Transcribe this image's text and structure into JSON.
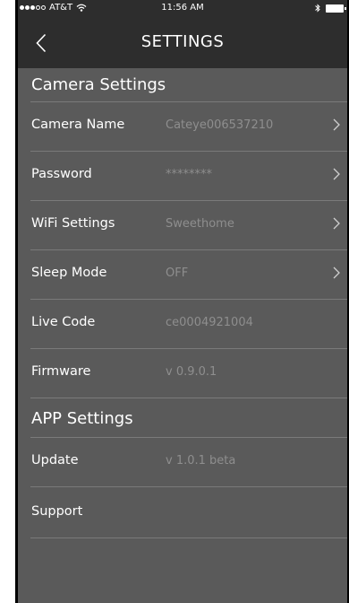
{
  "status_bar": {
    "carrier": "AT&T",
    "time": "11:56 AM"
  },
  "nav": {
    "title": "SETTINGS"
  },
  "sections": [
    {
      "title": "Camera Settings",
      "rows": [
        {
          "label": "Camera Name",
          "value": "Cateye006537210",
          "has_chevron": true
        },
        {
          "label": "Password",
          "value": "********",
          "has_chevron": true
        },
        {
          "label": "WiFi Settings",
          "value": "Sweethome",
          "has_chevron": true
        },
        {
          "label": "Sleep Mode",
          "value": "OFF",
          "has_chevron": true
        },
        {
          "label": "Live Code",
          "value": "ce0004921004",
          "has_chevron": false
        },
        {
          "label": "Firmware",
          "value": "v 0.9.0.1",
          "has_chevron": false
        }
      ]
    },
    {
      "title": "APP Settings",
      "rows": [
        {
          "label": "Update",
          "value": "v 1.0.1 beta",
          "has_chevron": false
        },
        {
          "label": "Support",
          "value": "",
          "has_chevron": false
        }
      ]
    }
  ],
  "colors": {
    "background": "#5a5a5a",
    "bar": "#2d2d2d",
    "label": "#ffffff",
    "value": "#8e8e8e",
    "divider": "#7a7a7a"
  },
  "icons": {
    "back": "chevron-left-icon",
    "row": "chevron-right-icon",
    "wifi": "wifi-icon",
    "bluetooth": "bluetooth-icon",
    "battery": "battery-icon",
    "signal": "signal-dots-icon"
  }
}
